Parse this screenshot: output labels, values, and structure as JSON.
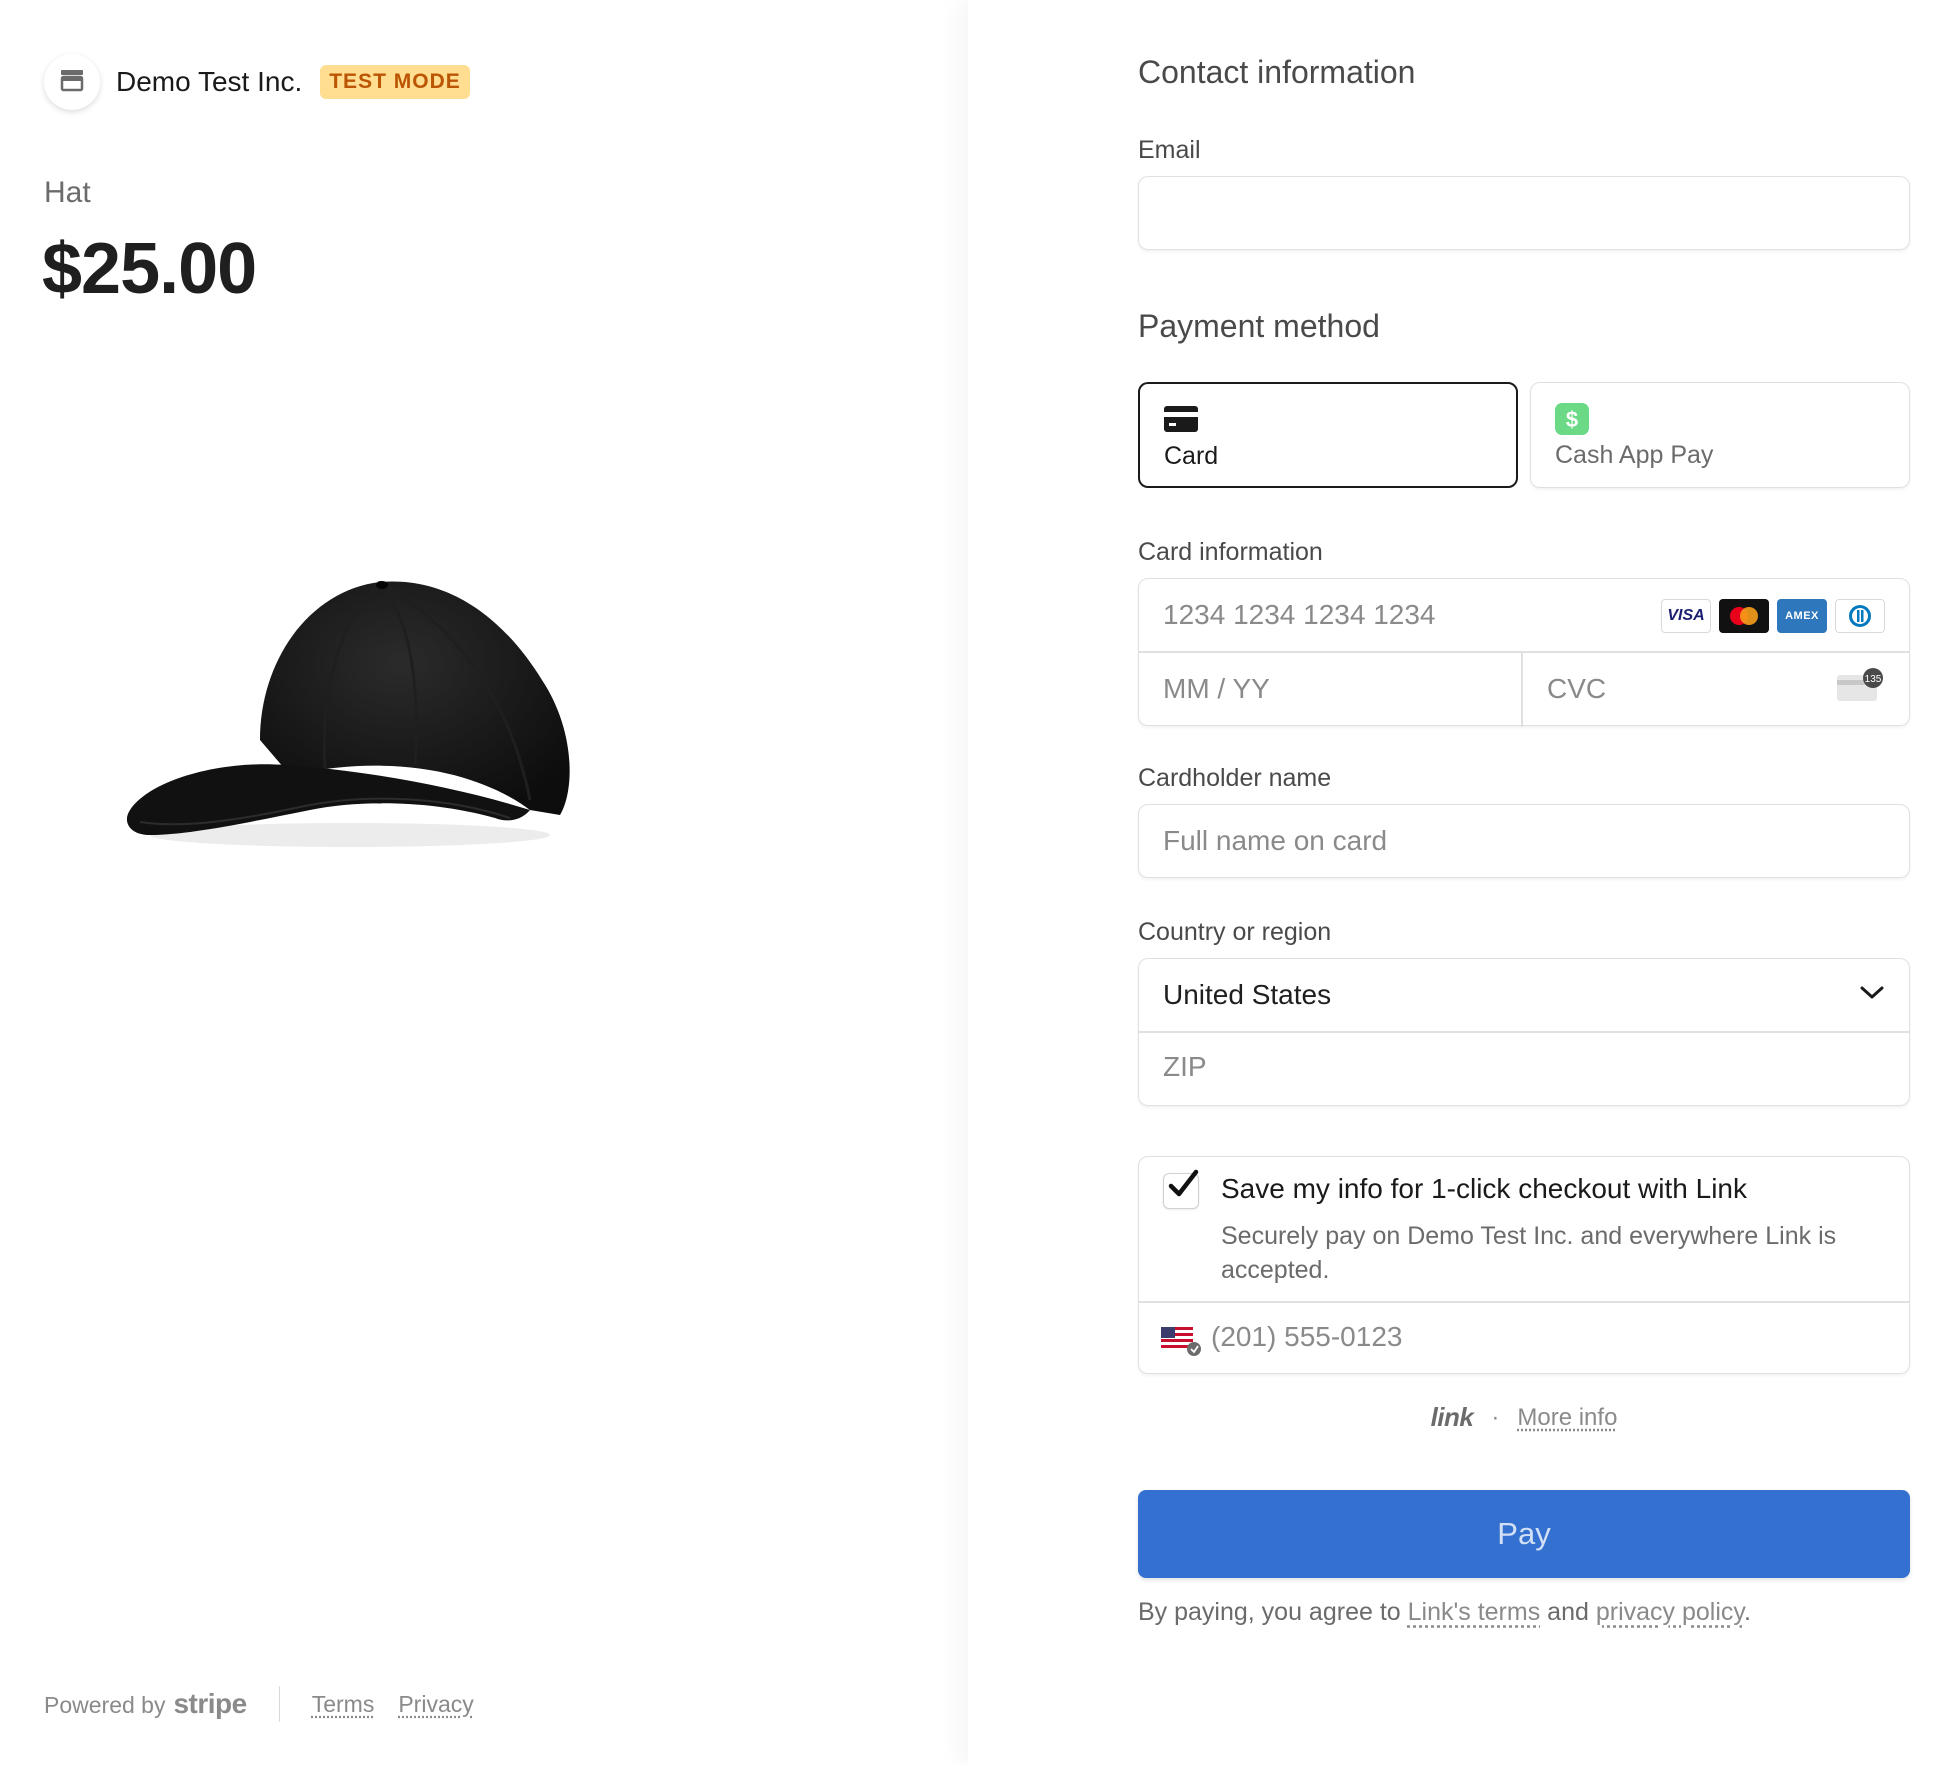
{
  "merchant": {
    "name": "Demo Test Inc.",
    "badge": "TEST MODE",
    "icon": "store-icon"
  },
  "product": {
    "name": "Hat",
    "price": "$25.00",
    "image": "black-baseball-cap"
  },
  "footer": {
    "powered_by": "Powered by",
    "brand": "stripe",
    "terms": "Terms",
    "privacy": "Privacy"
  },
  "contact": {
    "title": "Contact information",
    "email_label": "Email",
    "email_value": ""
  },
  "payment": {
    "title": "Payment method",
    "tabs": [
      {
        "label": "Card",
        "icon": "credit-card-icon",
        "selected": true
      },
      {
        "label": "Cash App Pay",
        "icon": "cash-app-icon",
        "selected": false
      }
    ]
  },
  "card": {
    "label": "Card information",
    "number_placeholder": "1234 1234 1234 1234",
    "expiry_placeholder": "MM / YY",
    "cvc_placeholder": "CVC",
    "cvc_hint": "135",
    "brands": [
      "VISA",
      "Mastercard",
      "AMEX",
      "Diners"
    ]
  },
  "cardholder": {
    "label": "Cardholder name",
    "placeholder": "Full name on card"
  },
  "country": {
    "label": "Country or region",
    "selected": "United States",
    "zip_placeholder": "ZIP"
  },
  "link_save": {
    "title": "Save my info for 1-click checkout with Link",
    "description": "Securely pay on Demo Test Inc. and everywhere Link is accepted.",
    "checked": true,
    "phone_placeholder": "(201) 555-0123"
  },
  "link_footer": {
    "logo": "link",
    "separator": "·",
    "more_info": "More info"
  },
  "pay": {
    "button_label": "Pay",
    "agree_prefix": "By paying, you agree to",
    "link_terms": "Link's terms",
    "and": "and",
    "privacy_policy": "privacy policy",
    "suffix": "."
  },
  "colors": {
    "accent": "#3370d0",
    "badge_bg": "#ffde92",
    "badge_text": "#bb5504"
  }
}
